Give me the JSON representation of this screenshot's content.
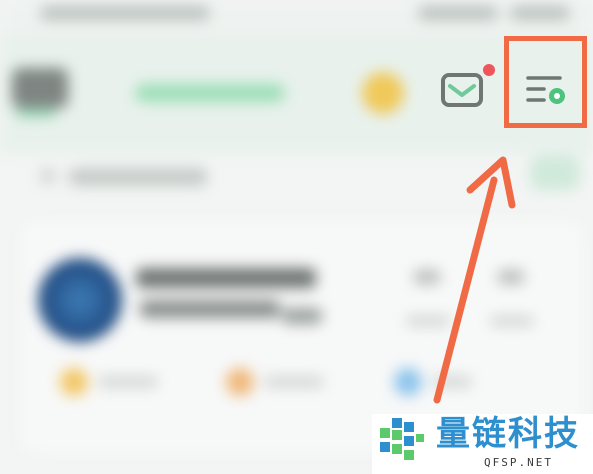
{
  "header": {
    "mail_badge_color": "#f0555c",
    "mail_icon": "mail-icon",
    "menu_icon": "menu-settings-icon"
  },
  "annotation": {
    "highlight_color": "#f06b45",
    "arrow_color": "#f06b45"
  },
  "watermark": {
    "title": "量链科技",
    "subtitle": "QFSP.NET",
    "logo_icon": "qfsp-logo-icon",
    "brand_colors": [
      "#2e8fcf",
      "#5cc96b"
    ]
  }
}
